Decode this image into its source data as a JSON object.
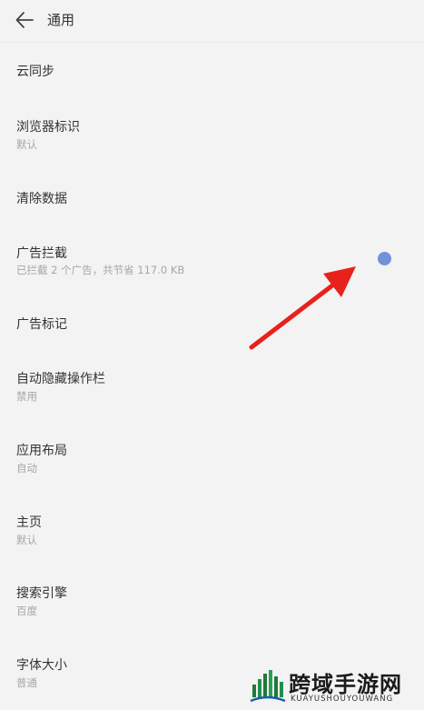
{
  "header": {
    "title": "通用"
  },
  "settings": [
    {
      "label": "云同步",
      "sub": ""
    },
    {
      "label": "浏览器标识",
      "sub": "默认"
    },
    {
      "label": "清除数据",
      "sub": ""
    },
    {
      "label": "广告拦截",
      "sub": "已拦截 2 个广告，共节省 117.0 KB"
    },
    {
      "label": "广告标记",
      "sub": ""
    },
    {
      "label": "自动隐藏操作栏",
      "sub": "禁用"
    },
    {
      "label": "应用布局",
      "sub": "自动"
    },
    {
      "label": "主页",
      "sub": "默认"
    },
    {
      "label": "搜索引擎",
      "sub": "百度"
    },
    {
      "label": "字体大小",
      "sub": "普通"
    }
  ],
  "watermark": {
    "name": "跨域手游网",
    "sub": "KUAYUSHOUYOUWANG"
  },
  "colors": {
    "annotation_arrow": "#e8211c",
    "touch_dot": "#7390db",
    "background": "#f3f3f3"
  }
}
